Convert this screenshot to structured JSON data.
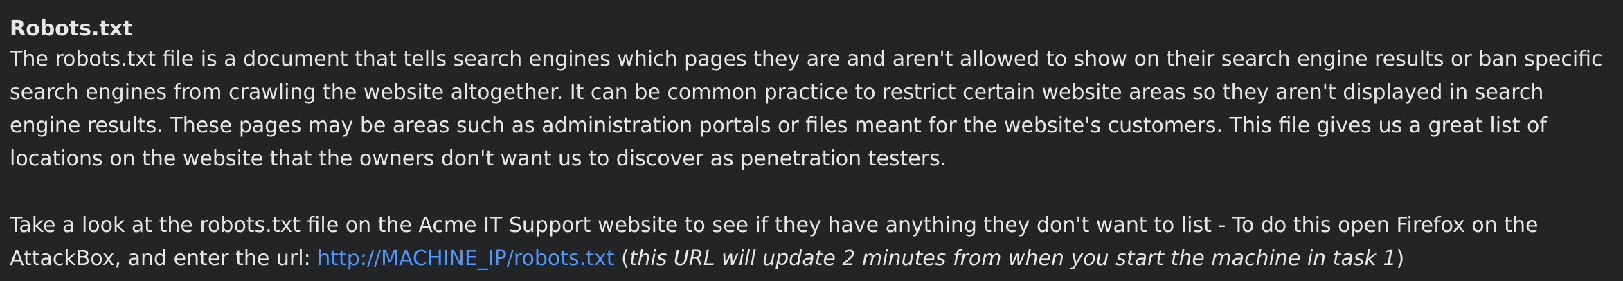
{
  "section": {
    "title": "Robots.txt",
    "paragraph1": "The robots.txt file is a document that tells search engines which pages they are and aren't allowed to show on their search engine results or ban specific search engines from crawling the website altogether. It can be common practice to restrict certain website areas so they aren't displayed in search engine results. These pages may be areas such as administration portals or files meant for the website's customers. This file gives us a great list of locations on the website that the owners don't want us to discover as penetration testers.",
    "paragraph2_prefix": "Take a look at the robots.txt file on the Acme IT Support website to see if they have anything they don't want to list - To do this open Firefox on the AttackBox, and enter the url: ",
    "link_text": "http://MACHINE_IP/robots.txt",
    "paren_open": " (",
    "note_italic": "this URL will update 2 minutes from when you start the machine in task 1",
    "paren_close": ")"
  },
  "colors": {
    "background": "#232426",
    "text": "#e6e7e9",
    "link": "#4f97ff"
  }
}
